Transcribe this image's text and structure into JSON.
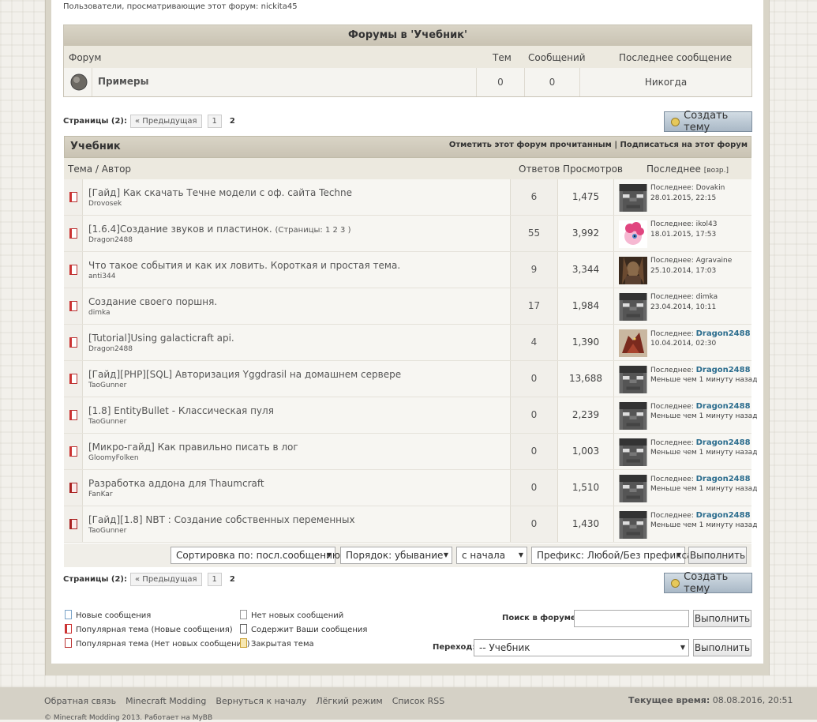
{
  "viewers": "Пользователи, просматривающие этот форум: nickita45",
  "forums": {
    "title": "Форумы в 'Учебник'",
    "cols": {
      "forum": "Форум",
      "topics": "Тем",
      "posts": "Сообщений",
      "last": "Последнее сообщение"
    },
    "row": {
      "name": "Примеры",
      "topics": "0",
      "posts": "0",
      "last": "Никогда"
    }
  },
  "pagination": {
    "label": "Страницы (2):",
    "prev": "« Предыдущая",
    "p1": "1",
    "p2": "2"
  },
  "new_thread": "Создать тему",
  "section": {
    "title": "Учебник",
    "mark_read": "Отметить этот форум прочитанным",
    "sep": "|",
    "subscribe": "Подписаться на этот форум",
    "col_topic": "Тема / Автор",
    "col_replies": "Ответов",
    "col_views": "Просмотров",
    "col_last": "Последнее",
    "col_last_small": "[возр.]"
  },
  "topics": [
    {
      "title": "[Гайд] Как скачать Течне модели с оф. сайта Techne",
      "pages": "",
      "author": "Drovosek",
      "replies": "6",
      "views": "1,475",
      "last_label": "Последнее: ",
      "last_user": "Dovakin",
      "last_time": "28.01.2015, 22:15",
      "avatar": "steve",
      "user_bold": false
    },
    {
      "title": "[1.6.4]Создание звуков и пластинок.",
      "pages": "(Страницы: 1 2 3 )",
      "author": "Dragon2488",
      "replies": "55",
      "views": "3,992",
      "last_label": "Последнее: ",
      "last_user": "ikol43",
      "last_time": "18.01.2015, 17:53",
      "avatar": "pony",
      "user_bold": false
    },
    {
      "title": "Что такое события и как их ловить. Короткая и простая тема.",
      "pages": "",
      "author": "anti344",
      "replies": "9",
      "views": "3,344",
      "last_label": "Последнее: ",
      "last_user": "Agravaine",
      "last_time": "25.10.2014, 17:03",
      "avatar": "warrior",
      "user_bold": false
    },
    {
      "title": "Создание своего поршня.",
      "pages": "",
      "author": "dimka",
      "replies": "17",
      "views": "1,984",
      "last_label": "Последнее: ",
      "last_user": "dimka",
      "last_time": "23.04.2014, 10:11",
      "avatar": "steve",
      "user_bold": false
    },
    {
      "title": "[Tutorial]Using galacticraft api.",
      "pages": "",
      "author": "Dragon2488",
      "replies": "4",
      "views": "1,390",
      "last_label": "Последнее: ",
      "last_user": "Dragon2488",
      "last_time": "10.04.2014, 02:30",
      "avatar": "dragon",
      "user_bold": true
    },
    {
      "title": "[Гайд][PHP][SQL] Авторизация Yggdrasil на домашнем сервере",
      "pages": "",
      "author": "TaoGunner",
      "replies": "0",
      "views": "13,688",
      "last_label": "Последнее: ",
      "last_user": "Dragon2488",
      "last_time": "Меньше чем 1 минуту назад",
      "avatar": "steve",
      "user_bold": true
    },
    {
      "title": "[1.8] EntityBullet - Классическая пуля",
      "pages": "",
      "author": "TaoGunner",
      "replies": "0",
      "views": "2,239",
      "last_label": "Последнее: ",
      "last_user": "Dragon2488",
      "last_time": "Меньше чем 1 минуту назад",
      "avatar": "steve",
      "user_bold": true
    },
    {
      "title": "[Микро-гайд] Как правильно писать в лог",
      "pages": "",
      "author": "GloomyFolken",
      "replies": "0",
      "views": "1,003",
      "last_label": "Последнее: ",
      "last_user": "Dragon2488",
      "last_time": "Меньше чем 1 минуту назад",
      "avatar": "steve",
      "user_bold": true
    },
    {
      "title": "Разработка аддона для Thaumcraft",
      "pages": "",
      "author": "FanKar",
      "replies": "0",
      "views": "1,510",
      "last_label": "Последнее: ",
      "last_user": "Dragon2488",
      "last_time": "Меньше чем 1 минуту назад",
      "avatar": "steve",
      "user_bold": true
    },
    {
      "title": "[Гайд][1.8] NBT : Создание собственных переменных",
      "pages": "",
      "author": "TaoGunner",
      "replies": "0",
      "views": "1,430",
      "last_label": "Последнее: ",
      "last_user": "Dragon2488",
      "last_time": "Меньше чем 1 минуту назад",
      "avatar": "steve",
      "user_bold": true
    }
  ],
  "controls": {
    "sort": "Сортировка по: посл.сообщению",
    "order": "Порядок: убывание",
    "from": "с начала",
    "prefix": "Префикс: Любой/Без префикса",
    "go": "Выполнить"
  },
  "legend": {
    "new": "Новые сообщения",
    "hot_new": "Популярная тема (Новые сообщения)",
    "hot_nonew": "Популярная тема (Нет новых сообщений)",
    "no_new": "Нет новых сообщений",
    "own": "Содержит Ваши сообщения",
    "closed": "Закрытая тема"
  },
  "search": {
    "label": "Поиск в форуме:",
    "value": "",
    "go": "Выполнить"
  },
  "jump": {
    "label": "Переход:",
    "value": "-- Учебник",
    "go": "Выполнить"
  },
  "footer": {
    "links": [
      "Обратная связь",
      "Minecraft Modding",
      "Вернуться к началу",
      "Лёгкий режим",
      "Список RSS"
    ],
    "time_label": "Текущее время:",
    "time_value": "08.08.2016, 20:51",
    "copyright": "© Minecraft Modding 2013. Работает на MyBB"
  }
}
